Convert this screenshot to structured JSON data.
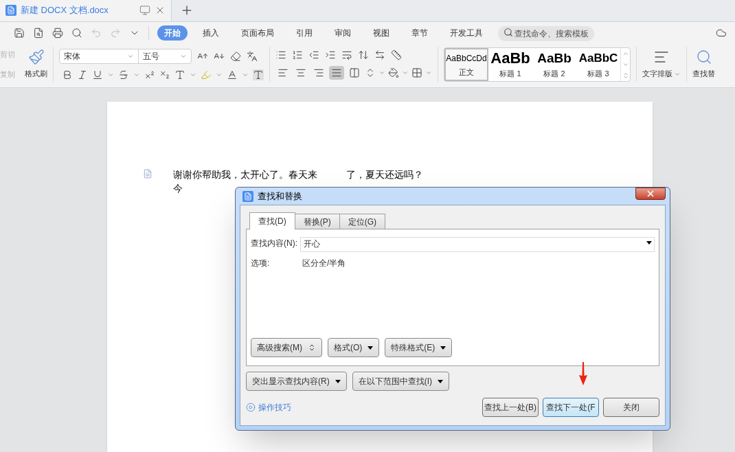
{
  "tabs": [
    {
      "label": "新建 DOCX 文档.docx"
    }
  ],
  "menu": [
    {
      "label": "开始",
      "selected": true
    },
    {
      "label": "插入",
      "selected": false
    },
    {
      "label": "页面布局",
      "selected": false
    },
    {
      "label": "引用",
      "selected": false
    },
    {
      "label": "审阅",
      "selected": false
    },
    {
      "label": "视图",
      "selected": false
    },
    {
      "label": "章节",
      "selected": false
    },
    {
      "label": "开发工具",
      "selected": false
    }
  ],
  "command_search": {
    "placeholder": "查找命令、搜索模板"
  },
  "ribbon": {
    "clipboard": [
      {
        "label": "剪切",
        "disabled": true
      },
      {
        "label": "复制",
        "disabled": true
      }
    ],
    "format_painter": "格式刷",
    "font": {
      "value": "宋体"
    },
    "font_size": {
      "value": "五号"
    },
    "alignment": [
      {
        "kind": "left",
        "selected": false
      },
      {
        "kind": "center",
        "selected": false
      },
      {
        "kind": "right",
        "selected": false
      },
      {
        "kind": "justify",
        "selected": true
      },
      {
        "kind": "distributed",
        "selected": false
      }
    ],
    "styles": [
      {
        "preview": "AaBbCcDd",
        "label": "正文",
        "kind": "body",
        "selected": true
      },
      {
        "preview": "AaBb",
        "label": "标题 1",
        "kind": "h1",
        "selected": false
      },
      {
        "preview": "AaBb",
        "label": "标题 2",
        "kind": "h2",
        "selected": false
      },
      {
        "preview": "AaBbC",
        "label": "标题 3",
        "kind": "h3",
        "selected": false
      }
    ],
    "text_layout": "文字排版",
    "find_replace": "查找替"
  },
  "document": {
    "lines": [
      [
        "谢谢你帮助我，太开心了。春天来",
        "了，夏天还远吗？"
      ],
      [
        "今"
      ]
    ]
  },
  "dialog": {
    "title": "查找和替换",
    "tabs": [
      {
        "label": "查找(D)",
        "selected": true
      },
      {
        "label": "替换(P)",
        "selected": false
      },
      {
        "label": "定位(G)",
        "selected": false
      }
    ],
    "find_label": "查找内容(N):",
    "find_value": "开心",
    "options_label": "选项:",
    "options_value": "区分全/半角",
    "panel_buttons": [
      {
        "label": "高级搜索(M)",
        "kind": "expand"
      },
      {
        "label": "格式(O)",
        "kind": "dropdown"
      },
      {
        "label": "特殊格式(E)",
        "kind": "dropdown"
      }
    ],
    "lower_buttons": [
      {
        "label": "突出显示查找内容(R)",
        "kind": "dropdown"
      },
      {
        "label": "在以下范围中查找(I)",
        "kind": "dropdown"
      }
    ],
    "tips_link": "操作技巧",
    "actions": [
      {
        "label": "查找上一处(B)",
        "selected": false
      },
      {
        "label": "查找下一处(F",
        "selected": true
      },
      {
        "label": "关闭",
        "selected": false
      }
    ]
  }
}
